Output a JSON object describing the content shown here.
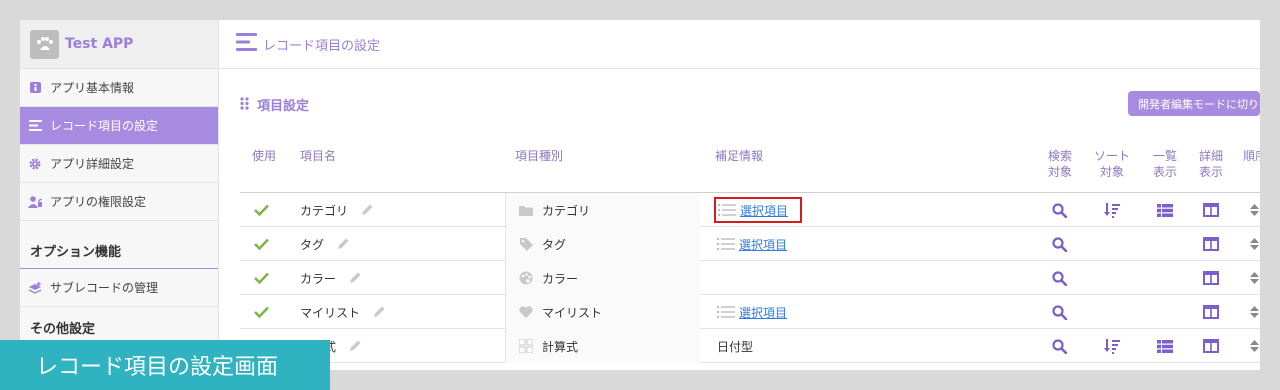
{
  "app": {
    "name": "Test APP"
  },
  "sidebar": {
    "items": [
      {
        "label": "アプリ基本情報"
      },
      {
        "label": "レコード項目の設定"
      },
      {
        "label": "アプリ詳細設定"
      },
      {
        "label": "アプリの権限設定"
      }
    ],
    "options_title": "オプション機能",
    "options_items": [
      {
        "label": "サブレコードの管理"
      }
    ],
    "other_title": "その他設定"
  },
  "header": {
    "title": "レコード項目の設定"
  },
  "section": {
    "title": "項目設定",
    "dev_mode_button": "開発者編集モードに切り替え"
  },
  "table": {
    "headers": {
      "use": "使用",
      "name": "項目名",
      "type": "項目種別",
      "info": "補足情報",
      "search_1": "検索",
      "search_2": "対象",
      "sort_1": "ソート",
      "sort_2": "対象",
      "list_1": "一覧",
      "list_2": "表示",
      "detail_1": "詳細",
      "detail_2": "表示",
      "order": "順序"
    },
    "rows": [
      {
        "name": "カテゴリ",
        "type": "カテゴリ",
        "type_icon": "folder-icon",
        "info": "選択項目",
        "info_kind": "link",
        "search": true,
        "sort": true,
        "list": true,
        "detail": true,
        "highlighted": true
      },
      {
        "name": "タグ",
        "type": "タグ",
        "type_icon": "tag-icon",
        "info": "選択項目",
        "info_kind": "link",
        "search": true,
        "sort": false,
        "list": false,
        "detail": true
      },
      {
        "name": "カラー",
        "type": "カラー",
        "type_icon": "palette-icon",
        "info": "",
        "info_kind": "none",
        "search": true,
        "sort": false,
        "list": false,
        "detail": true
      },
      {
        "name": "マイリスト",
        "type": "マイリスト",
        "type_icon": "heart-icon",
        "info": "選択項目",
        "info_kind": "link",
        "search": true,
        "sort": false,
        "list": false,
        "detail": true
      },
      {
        "name": "計算式",
        "type": "計算式",
        "type_icon": "calculator-icon",
        "info": "日付型",
        "info_kind": "text",
        "search": true,
        "sort": true,
        "list": true,
        "detail": true
      }
    ]
  },
  "caption": "レコード項目の設定画面",
  "colors": {
    "accent": "#a78be0",
    "accent_text": "#9b7fd9",
    "check": "#7cb342",
    "link": "#2f7de1",
    "highlight": "#d11d1d",
    "caption_bg": "#2fb3c1"
  }
}
